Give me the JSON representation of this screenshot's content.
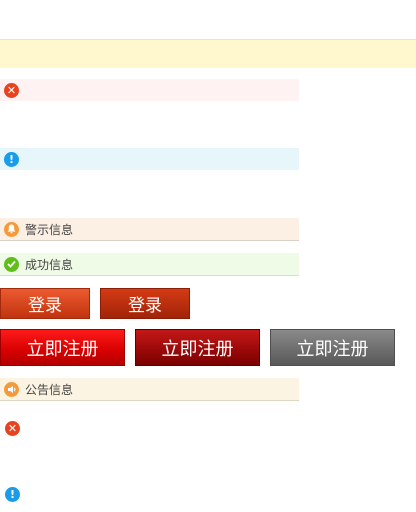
{
  "messages": {
    "warning": "警示信息",
    "success": "成功信息",
    "notice": "公告信息"
  },
  "buttons": {
    "login_primary": "登录",
    "login_secondary": "登录",
    "register_red": "立即注册",
    "register_dark": "立即注册",
    "register_gray": "立即注册"
  },
  "icons": {
    "error": "x-circle-icon",
    "info": "exclamation-circle-icon",
    "warning": "bell-icon",
    "success": "check-circle-icon",
    "notice": "megaphone-icon"
  },
  "colors": {
    "error": "#e8431f",
    "info": "#1a9ce8",
    "warning": "#f39a3d",
    "success": "#5fbd1c",
    "button_red": "#d60000",
    "button_gray": "#6c6c6c"
  }
}
